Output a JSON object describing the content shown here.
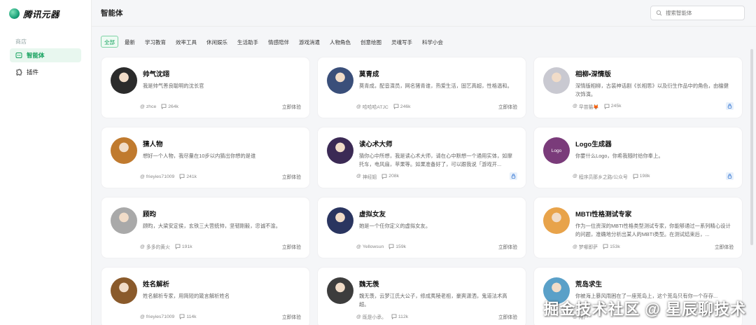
{
  "brand": {
    "name": "腾讯元器"
  },
  "sidebar": {
    "section": "商店",
    "items": [
      {
        "label": "智能体",
        "icon": "agent-icon",
        "active": true
      },
      {
        "label": "插件",
        "icon": "plugin-icon",
        "active": false
      }
    ]
  },
  "header": {
    "title": "智能体",
    "search_placeholder": "搜索智能体"
  },
  "tabs": [
    "全部",
    "最新",
    "学习教育",
    "效率工具",
    "休闲娱乐",
    "生活助手",
    "情感陪伴",
    "游戏消遣",
    "人物角色",
    "创意绘图",
    "灵魂写手",
    "科学小会"
  ],
  "cards": [
    {
      "title": "帅气沈翊",
      "desc": "我是帅气善良聪明的沈长官",
      "author": "zhce",
      "count": "264k",
      "action": "立即体验",
      "avatar_color": "#2b2b2b"
    },
    {
      "title": "莫青成",
      "desc": "莫青成，配音演员，网名猪青谁，热爱生活，固艺高超，性格温和。",
      "author": "哈哈哈ATJC",
      "count": "246k",
      "action": "立即体验",
      "avatar_color": "#3a4f7a"
    },
    {
      "title": "相柳•深情版",
      "desc": "深情版相柳，古装神话剧《长相思》以及衍生作品中的角色，由檀健次饰演。",
      "author": "早苗猫🦊",
      "count": "245k",
      "action": "",
      "avatar_color": "#c9c9d1"
    },
    {
      "title": "猜人物",
      "desc": "想好一个人物，我尽量在10步以内猜出你想的是谁",
      "author": "frieyies71009",
      "count": "241k",
      "action": "立即体验",
      "avatar_color": "#c07a2e"
    },
    {
      "title": "读心术大师",
      "desc": "猜你心中所想，我是读心术大师，请在心中默想一个通用实体，如摩托车，电风扇，苹果等。如果准备好了，可以跟我说「游戏开...",
      "author": "神经姐",
      "count": "208k",
      "action": "",
      "avatar_color": "#3b2a55"
    },
    {
      "title": "Logo生成器",
      "desc": "你要什么Logo，你希我随时给你奉上。",
      "author": "程序员那乡之路/公众号",
      "count": "198k",
      "action": "",
      "avatar_text": "Logo",
      "avatar_color": "#7a3b7a"
    },
    {
      "title": "顾昀",
      "desc": "顾昀，大梁安定侯，玄铁三大营统帅，坚韧刚毅，忠诚不渝。",
      "author": "多多的黄火",
      "count": "191k",
      "action": "立即体验",
      "avatar_color": "#a9a9a9"
    },
    {
      "title": "虚拟女友",
      "desc": "她是一个任你定义的虚拟女友。",
      "author": "Yellowsun",
      "count": "159k",
      "action": "立即体验",
      "avatar_color": "#2a3560"
    },
    {
      "title": "MBTI性格测试专家",
      "desc": "作为一位资深的MBTI性格类型测试专家，你能够通过一系列精心设计的问题，准确地分析出某人的MBTI类型。在测试结束后，...",
      "author": "梦哪即萨",
      "count": "153k",
      "action": "立即体验",
      "avatar_color": "#e8a34a"
    },
    {
      "title": "姓名解析",
      "desc": "姓名解析专家，用简短的箴言解析姓名",
      "author": "frieyies71009",
      "count": "114k",
      "action": "立即体验",
      "avatar_color": "#8a5a2b"
    },
    {
      "title": "魏无羡",
      "desc": "魏无羡，云梦江氏大公子，修成夷陵老祖，豪爽潇洒，鬼道法术高超。",
      "author": "既是小承。",
      "count": "112k",
      "action": "立即体验",
      "avatar_color": "#3d3d3d"
    },
    {
      "title": "荒岛求生",
      "desc": "你被海上暴风雨困在了一座荒岛上，这个荒岛只有你一个存存...",
      "author": "用户",
      "count": "",
      "action": "",
      "avatar_color": "#5aa0c8"
    }
  ],
  "watermark": "掘金技术社区 @ 星辰聊技术",
  "colors": {
    "accent": "#12a05c",
    "bg": "#f5f6f8"
  }
}
